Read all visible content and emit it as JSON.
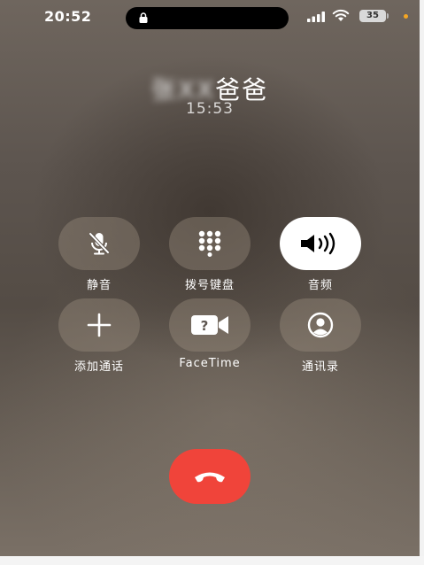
{
  "status_bar": {
    "time": "20:52",
    "battery": "35",
    "icons": [
      "lock-icon",
      "signal-icon",
      "wifi-icon",
      "battery-icon"
    ]
  },
  "call": {
    "caller_name_obscured": "张XX",
    "caller_name_visible": "爸爸",
    "duration": "15:53"
  },
  "controls": [
    {
      "label": "静音",
      "icon": "mute-icon",
      "active": false
    },
    {
      "label": "拨号键盘",
      "icon": "keypad-icon",
      "active": false
    },
    {
      "label": "音频",
      "icon": "speaker-icon",
      "active": true
    },
    {
      "label": "添加通话",
      "icon": "plus-icon",
      "active": false
    },
    {
      "label": "FaceTime",
      "icon": "facetime-icon",
      "active": false
    },
    {
      "label": "通讯录",
      "icon": "contacts-icon",
      "active": false
    }
  ],
  "end_call": {
    "icon": "end-call-icon"
  },
  "colors": {
    "end_call": "#f0443a",
    "active_button": "#ffffff",
    "battery_dot": "#f5a623"
  }
}
